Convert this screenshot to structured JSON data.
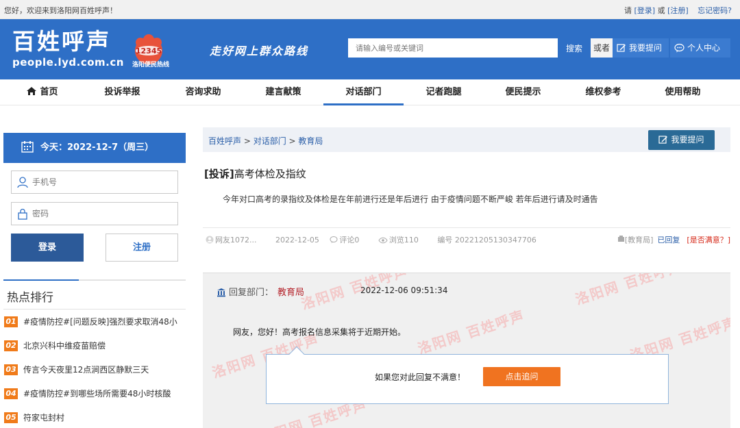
{
  "topbar": {
    "welcome": "您好，欢迎来到洛阳网百姓呼声！",
    "prefix": "请",
    "login": "[登录]",
    "or": "或",
    "register": "[注册]",
    "forgot": "忘记密码?"
  },
  "header": {
    "logo_main": "百姓呼声",
    "logo_sub": "people.lyd.com.cn",
    "badge_number": "12345",
    "badge_text": "洛阳便民热线",
    "slogan": "走好网上群众路线",
    "search_placeholder": "请输入编号或关键词",
    "search_button": "搜索",
    "or_label": "或者",
    "ask_button": "我要提问",
    "profile_button": "个人中心",
    "brand_color": "#2e6fc6"
  },
  "nav": {
    "items": [
      "首页",
      "投诉举报",
      "咨询求助",
      "建言献策",
      "对话部门",
      "记者跑腿",
      "便民提示",
      "维权参考",
      "使用帮助"
    ],
    "active": "对话部门"
  },
  "sidebar": {
    "date": "今天：2022-12-7（周三）",
    "phone_placeholder": "手机号",
    "password_placeholder": "密码",
    "login_button": "登录",
    "register_button": "注册",
    "hot_title": "热点排行",
    "hot_items": [
      {
        "num": "01",
        "text": "#疫情防控#[问题反映]强烈要求取消48小"
      },
      {
        "num": "02",
        "text": "北京兴科中维疫苗赔偿"
      },
      {
        "num": "03",
        "text": "传言今天夜里12点涧西区静默三天"
      },
      {
        "num": "04",
        "text": "#疫情防控#到哪些场所需要48小时核酸"
      },
      {
        "num": "05",
        "text": "符家屯封村"
      }
    ],
    "hot_color": "#f07b1a"
  },
  "main": {
    "breadcrumb": [
      "百姓呼声",
      "对话部门",
      "教育局"
    ],
    "breadcrumb_sep": " > ",
    "ask_button": "我要提问",
    "post": {
      "tag": "[投诉]",
      "title": "高考体检及指纹",
      "body": "今年对口高考的录指纹及体检是在年前进行还是年后进行 由于疫情问题不断严峻 若年后进行请及时通告",
      "user": "网友1072...",
      "date": "2022-12-05",
      "comments": "评论0",
      "views": "浏览110",
      "number": "编号 20221205130347706",
      "dept_tag": "[教育局]",
      "status": "已回复",
      "satisfied": "[是否满意？]"
    },
    "reply": {
      "dept_label": "回复部门：",
      "dept": "教育局",
      "time": "2022-12-06 09:51:34",
      "body": "网友，您好！高考报名信息采集将于近期开始。",
      "watermark": "洛阳网 百姓呼声"
    },
    "feedback": {
      "question": "如果您对此回复不满意！",
      "button": "点击追问",
      "button_color": "#f07320"
    }
  }
}
